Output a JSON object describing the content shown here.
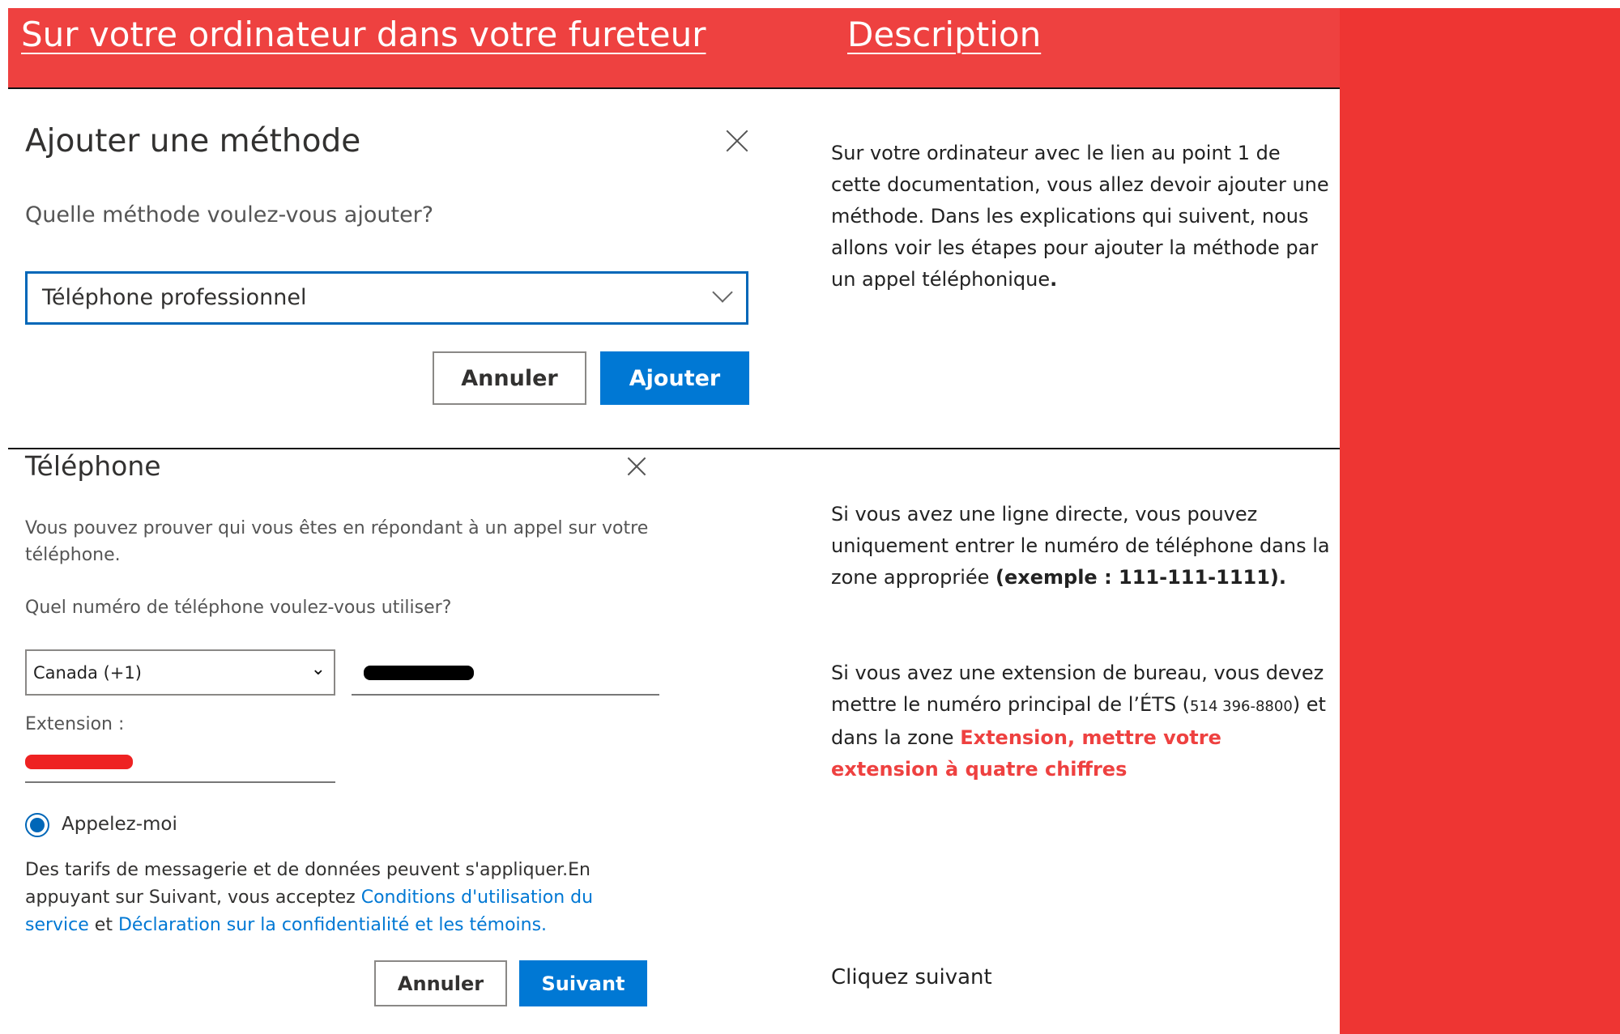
{
  "header": {
    "left_title": "Sur votre ordinateur dans votre fureteur",
    "right_title": "Description"
  },
  "dialog1": {
    "title": "Ajouter une méthode",
    "question": "Quelle méthode voulez-vous ajouter?",
    "selected_method": "Téléphone professionnel",
    "cancel_label": "Annuler",
    "add_label": "Ajouter"
  },
  "description1": {
    "text": "Sur votre ordinateur avec le lien au point 1 de cette documentation, vous allez devoir ajouter une méthode. Dans les explications qui suivent, nous allons voir les étapes pour ajouter la méthode par un appel téléphonique",
    "end": "."
  },
  "dialog2": {
    "title": "Téléphone",
    "intro_line1": "Vous pouvez prouver qui vous êtes en répondant à un appel sur votre",
    "intro_line2": "téléphone.",
    "question": "Quel numéro de téléphone voulez-vous utiliser?",
    "country": "Canada (+1)",
    "extension_label": "Extension :",
    "radio_label": "Appelez-moi",
    "terms_line1": "Des tarifs de messagerie et de données peuvent s'appliquer.En",
    "terms_line2_pre": "appuyant sur Suivant, vous acceptez ",
    "terms_link1a": "Conditions d'utilisation du",
    "terms_link1b": "service",
    "terms_and": " et ",
    "terms_link2": "Déclaration sur la confidentialité et les témoins.",
    "cancel_label": "Annuler",
    "next_label": "Suivant"
  },
  "description2": {
    "text": "Si vous avez une ligne directe, vous pouvez uniquement entrer le numéro de téléphone dans la zone appropriée ",
    "example": "(exemple : 111-111-1111)."
  },
  "description3": {
    "text_pre": "Si vous avez une extension de bureau, vous devez mettre le numéro principal de l’ÉTS (",
    "phone": "514 396-8800",
    "text_mid": ") et dans la zone ",
    "highlight": "Extension, mettre votre extension à quatre chiffres"
  },
  "description4": {
    "text": "Cliquez suivant"
  },
  "colors": {
    "header_red": "#EE4140",
    "side_red": "#EE3533",
    "primary_blue": "#0078D4",
    "redaction_red": "#EE2222"
  }
}
